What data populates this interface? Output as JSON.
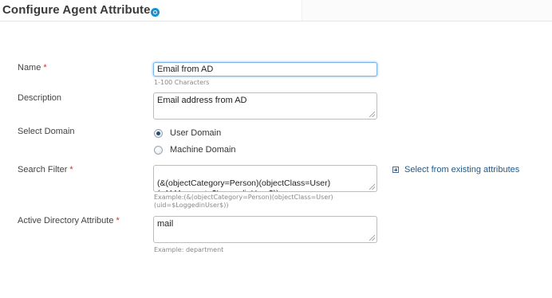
{
  "page": {
    "title": "Configure Agent Attribute",
    "help_icon": "help-circle-icon"
  },
  "form": {
    "name": {
      "label": "Name",
      "required": "*",
      "value": "Email from AD",
      "hint": "1-100 Characters"
    },
    "description": {
      "label": "Description",
      "value": "Email address from AD"
    },
    "domain": {
      "label": "Select Domain",
      "options": [
        {
          "label": "User Domain",
          "checked": true
        },
        {
          "label": "Machine Domain",
          "checked": false
        }
      ]
    },
    "search_filter": {
      "label": "Search Filter",
      "required": "*",
      "value": "(&(objectCategory=Person)(objectClass=User)\n(sAMAccount=$LoggedinUser$))",
      "hint_line1": "Example:(&(objectCategory=Person)(objectClass=User)",
      "hint_line2": "(uid=$LoggedinUser$))",
      "link": "Select from existing attributes",
      "link_icon": "plus-box-icon"
    },
    "ad_attribute": {
      "label": "Active Directory Attribute",
      "required": "*",
      "value": "mail",
      "hint": "Example: department"
    }
  },
  "colors": {
    "accent": "#1b8fcd",
    "required": "#d32b2b",
    "link": "#1f5a8c"
  }
}
